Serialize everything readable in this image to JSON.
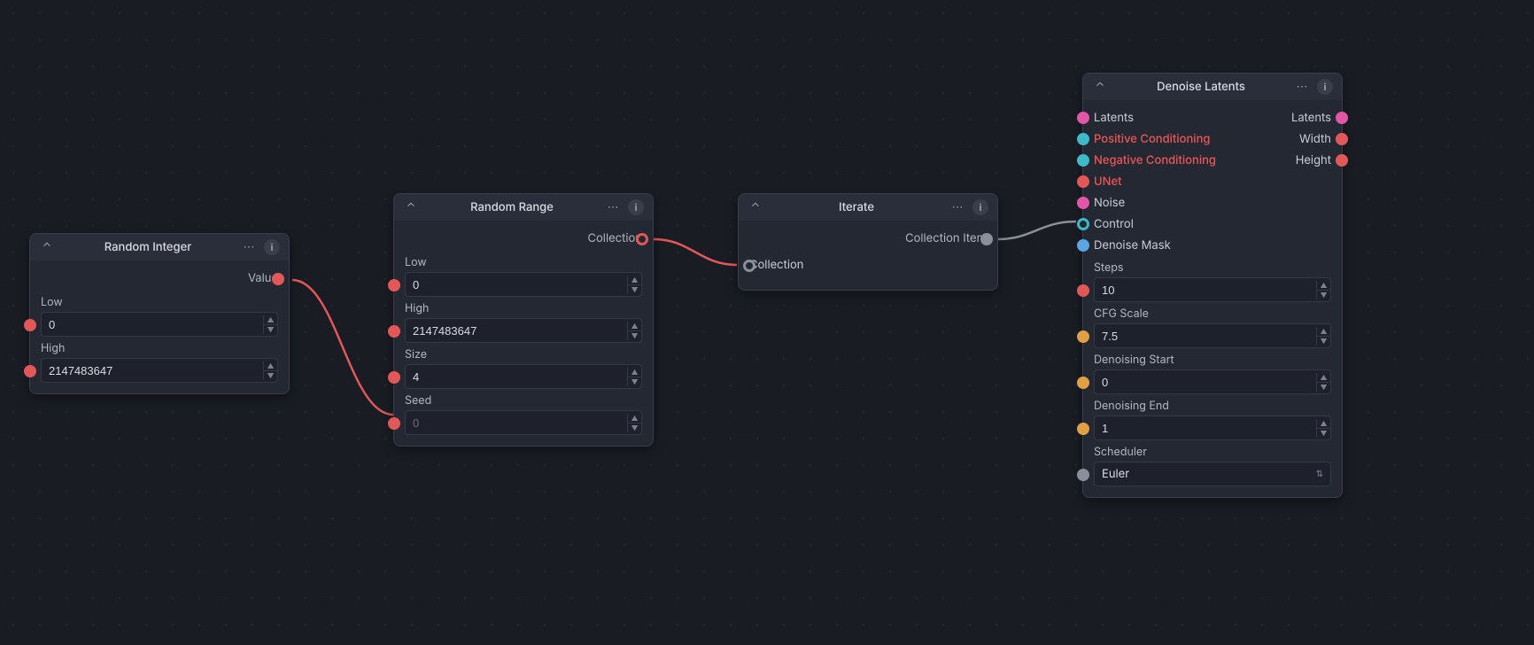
{
  "nodes": {
    "random_integer": {
      "title": "Random Integer",
      "outputs": {
        "value": "Value"
      },
      "fields": {
        "low": {
          "label": "Low",
          "value": "0"
        },
        "high": {
          "label": "High",
          "value": "2147483647"
        }
      }
    },
    "random_range": {
      "title": "Random Range",
      "outputs": {
        "collection": "Collection"
      },
      "fields": {
        "low": {
          "label": "Low",
          "value": "0"
        },
        "high": {
          "label": "High",
          "value": "2147483647"
        },
        "size": {
          "label": "Size",
          "value": "4"
        },
        "seed": {
          "label": "Seed",
          "value": "0"
        }
      }
    },
    "iterate": {
      "title": "Iterate",
      "outputs": {
        "collection_item": "Collection Item"
      },
      "inputs": {
        "collection": "Collection"
      }
    },
    "denoise": {
      "title": "Denoise Latents",
      "io": {
        "latents_in": "Latents",
        "latents_out": "Latents",
        "pos_cond": "Positive Conditioning",
        "width": "Width",
        "neg_cond": "Negative Conditioning",
        "height": "Height",
        "unet": "UNet",
        "noise": "Noise",
        "control": "Control",
        "denoise_mask": "Denoise Mask"
      },
      "fields": {
        "steps": {
          "label": "Steps",
          "value": "10"
        },
        "cfg": {
          "label": "CFG Scale",
          "value": "7.5"
        },
        "denoise_start": {
          "label": "Denoising Start",
          "value": "0"
        },
        "denoise_end": {
          "label": "Denoising End",
          "value": "1"
        },
        "scheduler": {
          "label": "Scheduler",
          "value": "Euler"
        }
      }
    }
  },
  "colors": {
    "red": "#e25858",
    "orange": "#e2a044",
    "pink": "#e256a8",
    "cyan": "#3fb9c8",
    "blue": "#5aa6e2",
    "grey": "#8a8f9c",
    "light": "#c8ccd6"
  }
}
